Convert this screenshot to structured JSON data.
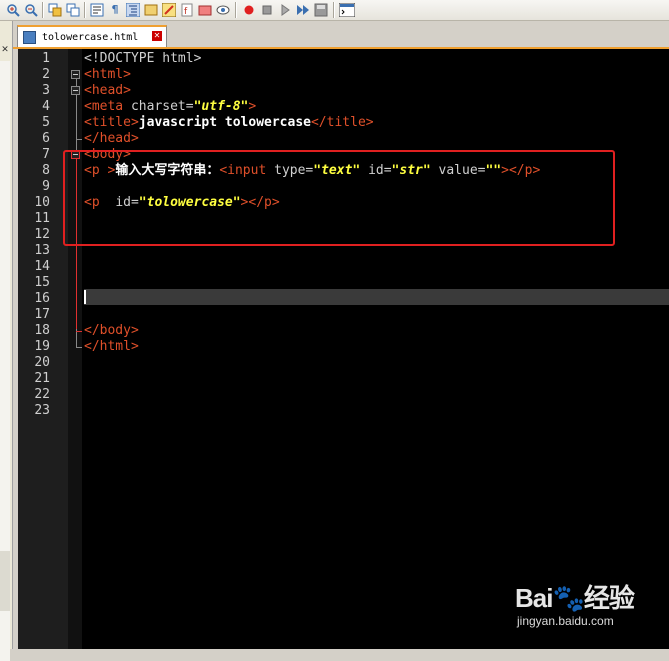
{
  "toolbar": {
    "icons": [
      "zoom-in-icon",
      "zoom-out-icon",
      "sync-vertical-icon",
      "sync-horizontal-icon",
      "word-wrap-icon",
      "show-all-chars-icon",
      "indent-guide-icon",
      "user-lang-icon",
      "doc-map-icon",
      "function-list-icon",
      "folder-workspace-icon",
      "monitoring-icon",
      "record-macro-icon",
      "stop-record-icon",
      "playback-icon",
      "run-macro-multiple-icon",
      "save-macro-icon",
      "console-icon"
    ]
  },
  "tab": {
    "label": "tolowercase.html"
  },
  "editor": {
    "line_numbers": [
      "1",
      "2",
      "3",
      "4",
      "5",
      "6",
      "7",
      "8",
      "9",
      "10",
      "11",
      "12",
      "13",
      "14",
      "15",
      "16",
      "17",
      "18",
      "19",
      "20",
      "21",
      "22",
      "23"
    ],
    "lines": {
      "l1": "<!DOCTYPE html>",
      "l2_tag": "<html>",
      "l3_tag": "<head>",
      "l4_open": "<meta",
      "l4_attr": "charset=",
      "l4_val": "\"utf-8\"",
      "l4_close": ">",
      "l5_open": "<title>",
      "l5_text": "javascript tolowercase",
      "l5_close": "</title>",
      "l6_tag": "</head>",
      "l7_tag": "<body>",
      "l8_p": "<p >",
      "l8_text": "输入大写字符串：",
      "l8_input": "<input",
      "l8_type_attr": "type=",
      "l8_type_val": "\"text\"",
      "l8_id_attr": "id=",
      "l8_id_val": "\"str\"",
      "l8_value_attr": "value=",
      "l8_value_val": "\"\"",
      "l8_end": "></p>",
      "l10_p": "<p",
      "l10_id_attr": "id=",
      "l10_id_val": "\"tolowercase\"",
      "l10_end": "></p>",
      "l18_tag": "</body>",
      "l19_tag": "</html>"
    }
  },
  "watermark": {
    "logo": "Bai🐾经验",
    "url": "jingyan.baidu.com"
  }
}
